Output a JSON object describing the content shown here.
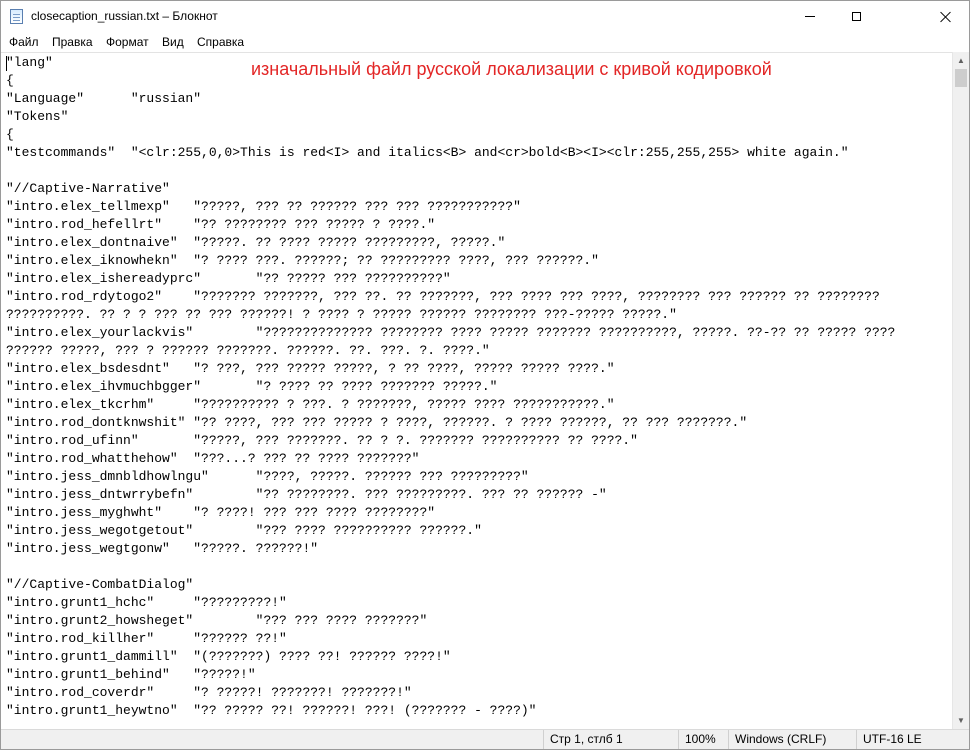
{
  "window": {
    "title": "closecaption_russian.txt – Блокнот"
  },
  "menu": [
    "Файл",
    "Правка",
    "Формат",
    "Вид",
    "Справка"
  ],
  "annotation": "изначальный файл русской локализации с кривой кодировкой",
  "editor": {
    "lines": [
      "\"lang\"",
      "{",
      "\"Language\"      \"russian\"",
      "\"Tokens\"",
      "{",
      "\"testcommands\"  \"<clr:255,0,0>This is red<I> and italics<B> and<cr>bold<B><I><clr:255,255,255> white again.\"",
      "",
      "\"//Captive-Narrative\"",
      "\"intro.elex_tellmexp\"   \"?????, ??? ?? ?????? ??? ??? ???????????\"",
      "\"intro.rod_hefellrt\"    \"?? ???????? ??? ????? ? ????.\"",
      "\"intro.elex_dontnaive\"  \"?????. ?? ???? ????? ?????????, ?????.\"",
      "\"intro.elex_iknowhekn\"  \"? ???? ???. ??????; ?? ????????? ????, ??? ??????.\"",
      "\"intro.elex_ishereadyprc\"       \"?? ????? ??? ??????????\"",
      "\"intro.rod_rdytogo2\"    \"??????? ???????, ??? ??. ?? ???????, ??? ???? ??? ????, ???????? ??? ?????? ?? ????????",
      "??????????. ?? ? ? ??? ?? ??? ??????! ? ???? ? ????? ?????? ???????? ???-????? ?????.\"",
      "\"intro.elex_yourlackvis\"        \"?????????????? ???????? ???? ????? ??????? ??????????, ?????. ??-?? ?? ????? ????",
      "?????? ?????, ??? ? ?????? ???????. ??????. ??. ???. ?. ????.\"",
      "\"intro.elex_bsdesdnt\"   \"? ???, ??? ????? ?????, ? ?? ????, ????? ????? ????.\"",
      "\"intro.elex_ihvmuchbgger\"       \"? ???? ?? ???? ??????? ?????.\"",
      "\"intro.elex_tkcrhm\"     \"?????????? ? ???. ? ???????, ????? ???? ???????????.\"",
      "\"intro.rod_dontknwshit\" \"?? ????, ??? ??? ????? ? ????, ??????. ? ???? ??????, ?? ??? ???????.\"",
      "\"intro.rod_ufinn\"       \"?????, ??? ???????. ?? ? ?. ??????? ?????????? ?? ????.\"",
      "\"intro.rod_whatthehow\"  \"???...? ??? ?? ???? ???????\"",
      "\"intro.jess_dmnbldhowlngu\"      \"????, ?????. ?????? ??? ?????????\"",
      "\"intro.jess_dntwrrybefn\"        \"?? ????????. ??? ?????????. ??? ?? ?????? -\"",
      "\"intro.jess_myghwht\"    \"? ????! ??? ??? ???? ????????\"",
      "\"intro.jess_wegotgetout\"        \"??? ???? ?????????? ??????.\"",
      "\"intro.jess_wegtgonw\"   \"?????. ??????!\"",
      "",
      "\"//Captive-CombatDialog\"",
      "\"intro.grunt1_hchc\"     \"?????????!\"",
      "\"intro.grunt2_howsheget\"        \"??? ??? ???? ???????\"",
      "\"intro.rod_killher\"     \"?????? ??!\"",
      "\"intro.grunt1_dammill\"  \"(???????) ???? ??! ?????? ????!\"",
      "\"intro.grunt1_behind\"   \"?????!\"",
      "\"intro.rod_coverdr\"     \"? ?????! ???????! ???????!\"",
      "\"intro.grunt1_heywtno\"  \"?? ????? ??! ??????! ???! (??????? - ????)\""
    ]
  },
  "status": {
    "position": "Стр 1, стлб 1",
    "zoom": "100%",
    "line_endings": "Windows (CRLF)",
    "encoding": "UTF-16 LE"
  }
}
